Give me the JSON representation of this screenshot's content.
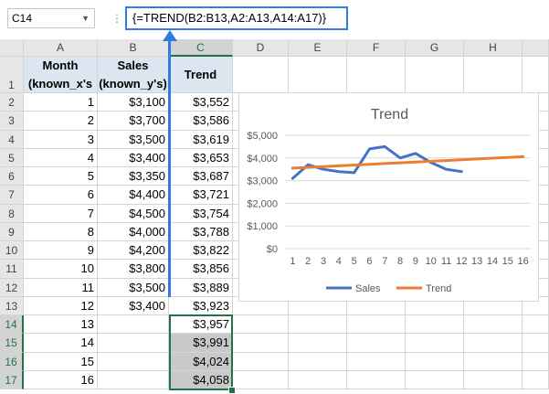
{
  "formula_bar": {
    "name_box": "C14",
    "name_box_arrow": "▼",
    "separator": "⋮",
    "formula": "{=TREND(B2:B13,A2:A13,A14:A17)}"
  },
  "columns": [
    "",
    "A",
    "B",
    "C",
    "D",
    "E",
    "F",
    "G",
    "H"
  ],
  "header_row": {
    "row_label": "1",
    "a_line1": "Month",
    "a_line2": "(known_x's",
    "b_line1": "Sales",
    "b_line2": "(known_y's)",
    "c": "Trend"
  },
  "rows": [
    {
      "r": "2",
      "a": "1",
      "b": "$3,100",
      "c": "$3,552"
    },
    {
      "r": "3",
      "a": "2",
      "b": "$3,700",
      "c": "$3,586"
    },
    {
      "r": "4",
      "a": "3",
      "b": "$3,500",
      "c": "$3,619"
    },
    {
      "r": "5",
      "a": "4",
      "b": "$3,400",
      "c": "$3,653"
    },
    {
      "r": "6",
      "a": "5",
      "b": "$3,350",
      "c": "$3,687"
    },
    {
      "r": "7",
      "a": "6",
      "b": "$4,400",
      "c": "$3,721"
    },
    {
      "r": "8",
      "a": "7",
      "b": "$4,500",
      "c": "$3,754"
    },
    {
      "r": "9",
      "a": "8",
      "b": "$4,000",
      "c": "$3,788"
    },
    {
      "r": "10",
      "a": "9",
      "b": "$4,200",
      "c": "$3,822"
    },
    {
      "r": "11",
      "a": "10",
      "b": "$3,800",
      "c": "$3,856"
    },
    {
      "r": "12",
      "a": "11",
      "b": "$3,500",
      "c": "$3,889"
    },
    {
      "r": "13",
      "a": "12",
      "b": "$3,400",
      "c": "$3,923"
    },
    {
      "r": "14",
      "a": "13",
      "b": "",
      "c": "$3,957"
    },
    {
      "r": "15",
      "a": "14",
      "b": "",
      "c": "$3,991"
    },
    {
      "r": "16",
      "a": "15",
      "b": "",
      "c": "$4,024"
    },
    {
      "r": "17",
      "a": "16",
      "b": "",
      "c": "$4,058"
    }
  ],
  "colors": {
    "sales": "#4472C4",
    "trend": "#ED7D31",
    "selection": "#217346",
    "annotation": "#2F7CE0"
  },
  "chart_data": {
    "type": "line",
    "title": "Trend",
    "categories": [
      "1",
      "2",
      "3",
      "4",
      "5",
      "6",
      "7",
      "8",
      "9",
      "10",
      "11",
      "12",
      "13",
      "14",
      "15",
      "16"
    ],
    "series": [
      {
        "name": "Sales",
        "values": [
          3100,
          3700,
          3500,
          3400,
          3350,
          4400,
          4500,
          4000,
          4200,
          3800,
          3500,
          3400,
          null,
          null,
          null,
          null
        ]
      },
      {
        "name": "Trend",
        "values": [
          3552,
          3586,
          3619,
          3653,
          3687,
          3721,
          3754,
          3788,
          3822,
          3856,
          3889,
          3923,
          3957,
          3991,
          4024,
          4058
        ]
      }
    ],
    "yticks": [
      "$0",
      "$1,000",
      "$2,000",
      "$3,000",
      "$4,000",
      "$5,000"
    ],
    "ylim": [
      0,
      5000
    ],
    "grid": true,
    "legend": "bottom"
  }
}
